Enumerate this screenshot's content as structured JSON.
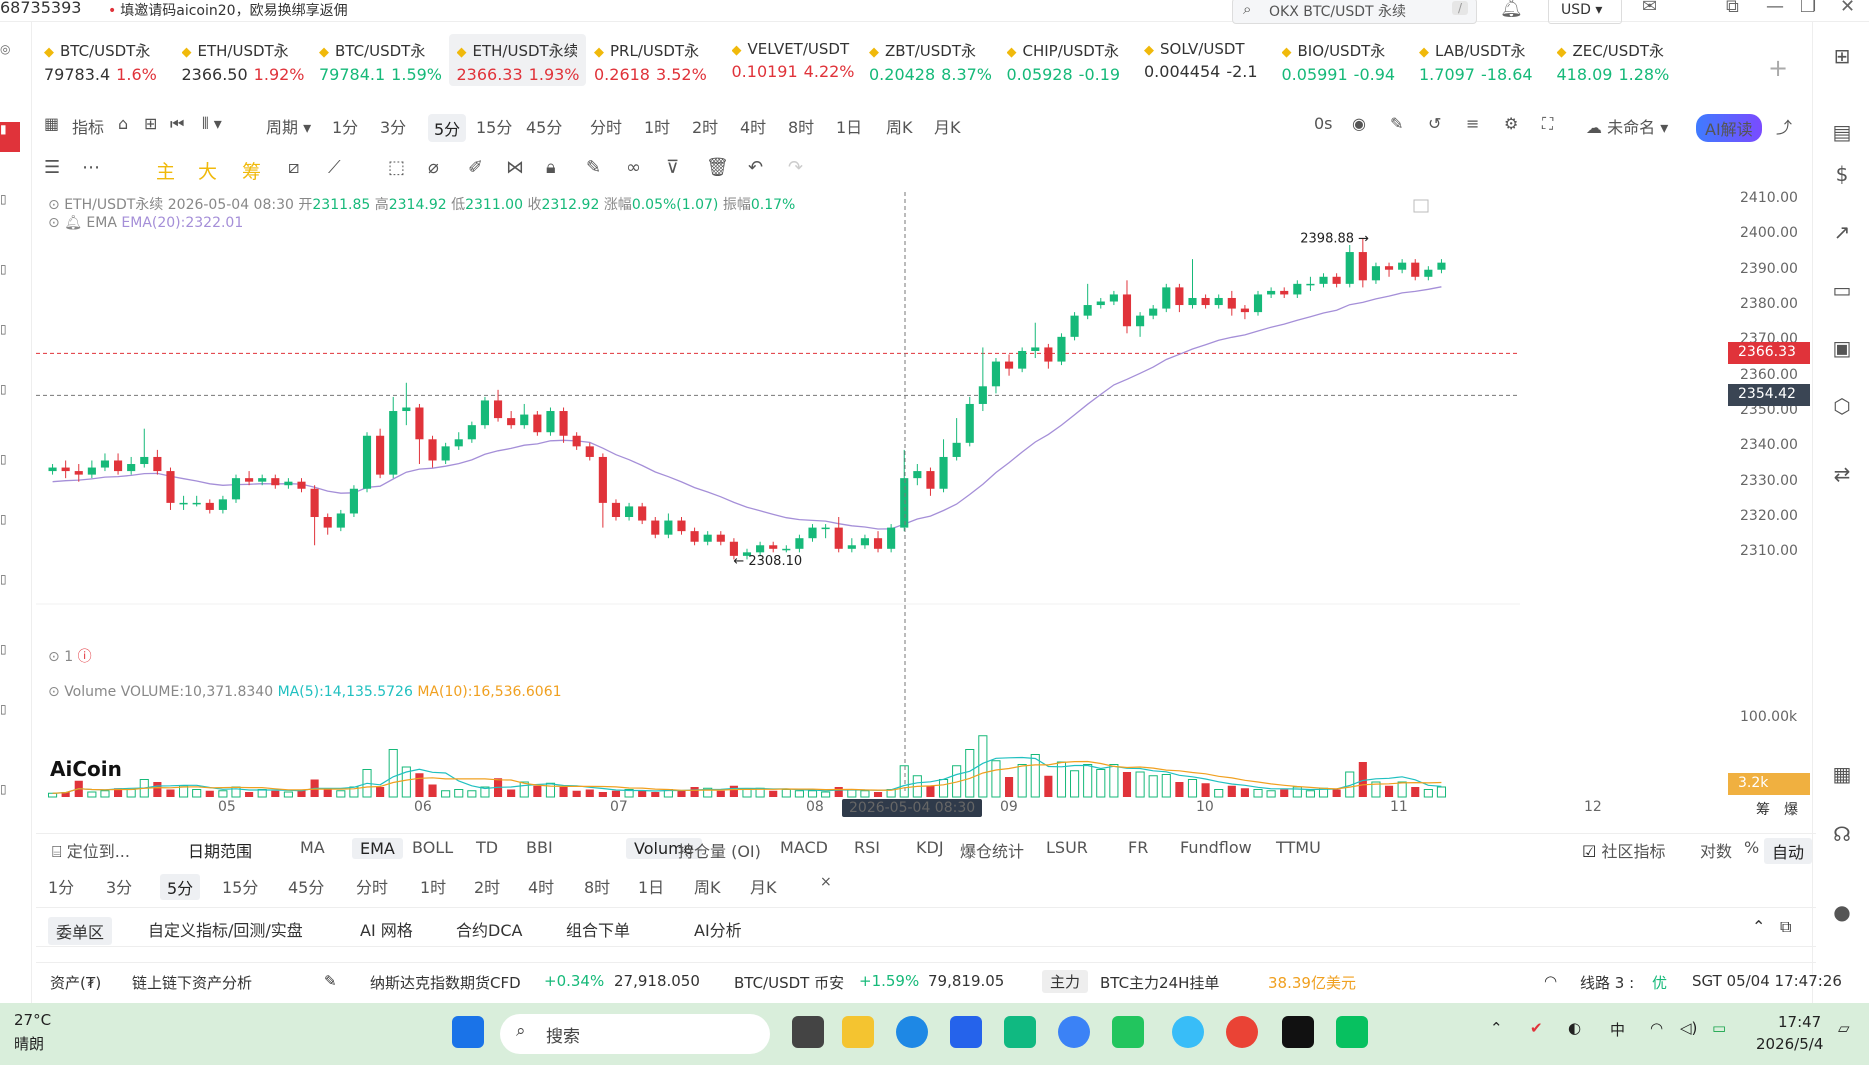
{
  "top": {
    "uid": "68735393",
    "promo": "填邀请码aicoin20，欧易换绑享返佣",
    "search_placeholder": "OKX BTC/USDT 永续",
    "search_shortcut": "/",
    "currency": "USD"
  },
  "tickers": [
    {
      "name": "BTC/USDT永",
      "price": "79783.4",
      "change": "1.6%",
      "dir": "dn",
      "price_dir": "neutral"
    },
    {
      "name": "ETH/USDT永",
      "price": "2366.50",
      "change": "1.92%",
      "dir": "dn",
      "price_dir": "neutral"
    },
    {
      "name": "BTC/USDT永",
      "price": "79784.1",
      "change": "1.59%",
      "dir": "up",
      "price_dir": "up"
    },
    {
      "name": "ETH/USDT永续",
      "price": "2366.33",
      "change": "1.93%",
      "dir": "dn",
      "price_dir": "dn",
      "active": true
    },
    {
      "name": "PRL/USDT永",
      "price": "0.2618",
      "change": "3.52%",
      "dir": "dn",
      "price_dir": "dn"
    },
    {
      "name": "VELVET/USDT",
      "price": "0.10191",
      "change": "4.22%",
      "dir": "dn",
      "price_dir": "dn"
    },
    {
      "name": "ZBT/USDT永",
      "price": "0.20428",
      "change": "8.37%",
      "dir": "up",
      "price_dir": "up"
    },
    {
      "name": "CHIP/USDT永",
      "price": "0.05928",
      "change": "-0.19",
      "dir": "up",
      "price_dir": "up"
    },
    {
      "name": "SOLV/USDT",
      "price": "0.004454",
      "change": "-2.1",
      "dir": "neutral",
      "price_dir": "neutral"
    },
    {
      "name": "BIO/USDT永",
      "price": "0.05991",
      "change": "-0.94",
      "dir": "up",
      "price_dir": "up"
    },
    {
      "name": "LAB/USDT永",
      "price": "1.7097",
      "change": "-18.64",
      "dir": "up",
      "price_dir": "up"
    },
    {
      "name": "ZEC/USDT永",
      "price": "418.09",
      "change": "1.28%",
      "dir": "up",
      "price_dir": "up"
    }
  ],
  "toolbar": {
    "indicators": "指标",
    "period": "周期",
    "timeframes": [
      "1分",
      "3分",
      "5分",
      "15分",
      "45分",
      "分时",
      "1时",
      "2时",
      "4时",
      "8时",
      "1日",
      "周K",
      "月K"
    ],
    "selected_tf": "5分",
    "countdown": "0s",
    "layout_name": "未命名",
    "ai_label": "AI解读"
  },
  "drawbar": {
    "labels": [
      "主",
      "大",
      "筹"
    ]
  },
  "chart": {
    "symbol": "ETH/USDT永续",
    "datetime": "2026-05-04 08:30",
    "open_label": "开",
    "open": "2311.85",
    "high_label": "高",
    "high": "2314.92",
    "low_label": "低",
    "low": "2311.00",
    "close_label": "收",
    "close": "2312.92",
    "chg_label": "涨幅",
    "chg": "0.05%(1.07)",
    "amp_label": "振幅",
    "amp": "0.17%",
    "ema_label": "EMA",
    "ema_value": "EMA(20):2322.01",
    "max_marker": "2398.88 →",
    "min_marker": "← 2308.10",
    "alert_count": "1",
    "price_ticks": [
      "2410.00",
      "2400.00",
      "2390.00",
      "2380.00",
      "2370.00",
      "2360.00",
      "2350.00",
      "2340.00",
      "2330.00",
      "2320.00",
      "2310.00"
    ],
    "last_price": "2366.33",
    "cursor_price": "2354.42",
    "volume_label": "Volume",
    "volume_value": "VOLUME:10,371.8340",
    "ma5": "MA(5):14,135.5726",
    "ma10": "MA(10):16,536.6061",
    "vol_tick": "100.00k",
    "vol_last": "3.2k",
    "date_ticks": [
      "05",
      "06",
      "07",
      "08",
      "09",
      "10",
      "11",
      "12"
    ],
    "cursor_date": "2026-05-04 08:30",
    "corner_labels": [
      "筹",
      "爆"
    ],
    "logo": "AiCoin"
  },
  "chart_data": {
    "type": "candlestick",
    "title": "ETH/USDT永续 5分",
    "ylim": [
      2305,
      2412
    ],
    "ema20_end": 2383,
    "high_marker": 2398.88,
    "low_marker": 2308.1,
    "candles": [
      [
        2333,
        2334,
        2332,
        2335
      ],
      [
        2334,
        2333,
        2331,
        2336
      ],
      [
        2333,
        2332,
        2330,
        2335
      ],
      [
        2332,
        2334,
        2331,
        2336
      ],
      [
        2334,
        2336,
        2333,
        2338
      ],
      [
        2336,
        2333,
        2332,
        2338
      ],
      [
        2333,
        2335,
        2332,
        2337
      ],
      [
        2335,
        2337,
        2334,
        2345
      ],
      [
        2337,
        2333,
        2332,
        2339
      ],
      [
        2333,
        2324,
        2322,
        2334
      ],
      [
        2324,
        2324,
        2322,
        2326
      ],
      [
        2324,
        2324,
        2323,
        2326
      ],
      [
        2324,
        2322,
        2321,
        2325
      ],
      [
        2322,
        2325,
        2321,
        2326
      ],
      [
        2325,
        2331,
        2324,
        2332
      ],
      [
        2331,
        2330,
        2329,
        2333
      ],
      [
        2330,
        2331,
        2329,
        2332
      ],
      [
        2331,
        2329,
        2328,
        2332
      ],
      [
        2329,
        2330,
        2328,
        2331
      ],
      [
        2330,
        2328,
        2327,
        2331
      ],
      [
        2328,
        2320,
        2312,
        2329
      ],
      [
        2320,
        2317,
        2315,
        2321
      ],
      [
        2317,
        2321,
        2316,
        2322
      ],
      [
        2321,
        2328,
        2320,
        2329
      ],
      [
        2328,
        2343,
        2327,
        2344
      ],
      [
        2343,
        2332,
        2331,
        2345
      ],
      [
        2332,
        2350,
        2331,
        2354
      ],
      [
        2350,
        2351,
        2346,
        2358
      ],
      [
        2351,
        2342,
        2335,
        2352
      ],
      [
        2342,
        2336,
        2334,
        2343
      ],
      [
        2336,
        2340,
        2335,
        2341
      ],
      [
        2340,
        2342,
        2339,
        2344
      ],
      [
        2342,
        2346,
        2341,
        2347
      ],
      [
        2346,
        2353,
        2345,
        2354
      ],
      [
        2353,
        2348,
        2347,
        2356
      ],
      [
        2348,
        2346,
        2345,
        2350
      ],
      [
        2346,
        2349,
        2345,
        2352
      ],
      [
        2349,
        2344,
        2343,
        2350
      ],
      [
        2344,
        2350,
        2343,
        2351
      ],
      [
        2350,
        2343,
        2341,
        2351
      ],
      [
        2343,
        2340,
        2339,
        2344
      ],
      [
        2340,
        2337,
        2336,
        2341
      ],
      [
        2337,
        2324,
        2317,
        2338
      ],
      [
        2324,
        2320,
        2319,
        2325
      ],
      [
        2320,
        2323,
        2319,
        2324
      ],
      [
        2323,
        2319,
        2318,
        2324
      ],
      [
        2319,
        2315,
        2314,
        2320
      ],
      [
        2315,
        2319,
        2314,
        2321
      ],
      [
        2319,
        2316,
        2315,
        2320
      ],
      [
        2316,
        2313,
        2312,
        2317
      ],
      [
        2313,
        2315,
        2312,
        2316
      ],
      [
        2315,
        2313,
        2312,
        2316
      ],
      [
        2313,
        2309,
        2308,
        2314
      ],
      [
        2309,
        2310,
        2308,
        2311
      ],
      [
        2310,
        2312,
        2309,
        2313
      ],
      [
        2312,
        2311,
        2310,
        2313
      ],
      [
        2311,
        2311,
        2310,
        2312
      ],
      [
        2311,
        2314,
        2310,
        2315
      ],
      [
        2314,
        2317,
        2313,
        2318
      ],
      [
        2317,
        2317,
        2314,
        2318
      ],
      [
        2317,
        2311,
        2310,
        2320
      ],
      [
        2311,
        2312,
        2310,
        2314
      ],
      [
        2312,
        2314,
        2311,
        2315
      ],
      [
        2314,
        2311,
        2310,
        2316
      ],
      [
        2311,
        2317,
        2310,
        2318
      ],
      [
        2317,
        2331,
        2316,
        2339
      ],
      [
        2331,
        2333,
        2329,
        2335
      ],
      [
        2333,
        2328,
        2326,
        2334
      ],
      [
        2328,
        2337,
        2327,
        2342
      ],
      [
        2337,
        2341,
        2336,
        2348
      ],
      [
        2341,
        2352,
        2340,
        2354
      ],
      [
        2352,
        2357,
        2350,
        2368
      ],
      [
        2357,
        2364,
        2355,
        2365
      ],
      [
        2364,
        2362,
        2360,
        2366
      ],
      [
        2362,
        2367,
        2361,
        2368
      ],
      [
        2367,
        2368,
        2365,
        2375
      ],
      [
        2368,
        2364,
        2362,
        2369
      ],
      [
        2364,
        2371,
        2363,
        2372
      ],
      [
        2371,
        2377,
        2370,
        2378
      ],
      [
        2377,
        2380,
        2376,
        2386
      ],
      [
        2380,
        2381,
        2379,
        2382
      ],
      [
        2381,
        2383,
        2380,
        2384
      ],
      [
        2383,
        2374,
        2372,
        2387
      ],
      [
        2374,
        2377,
        2371,
        2378
      ],
      [
        2377,
        2379,
        2376,
        2380
      ],
      [
        2379,
        2385,
        2378,
        2386
      ],
      [
        2385,
        2380,
        2378,
        2386
      ],
      [
        2380,
        2382,
        2379,
        2393
      ],
      [
        2382,
        2380,
        2379,
        2383
      ],
      [
        2380,
        2382,
        2379,
        2383
      ],
      [
        2382,
        2379,
        2377,
        2384
      ],
      [
        2379,
        2378,
        2376,
        2380
      ],
      [
        2378,
        2383,
        2377,
        2384
      ],
      [
        2383,
        2384,
        2382,
        2385
      ],
      [
        2384,
        2383,
        2382,
        2385
      ],
      [
        2383,
        2386,
        2382,
        2387
      ],
      [
        2386,
        2386,
        2384,
        2388
      ],
      [
        2386,
        2388,
        2385,
        2389
      ],
      [
        2388,
        2386,
        2385,
        2389
      ],
      [
        2386,
        2395,
        2385,
        2397
      ],
      [
        2395,
        2387,
        2385,
        2399
      ],
      [
        2387,
        2391,
        2386,
        2392
      ],
      [
        2391,
        2390,
        2388,
        2392
      ],
      [
        2390,
        2392,
        2389,
        2393
      ],
      [
        2392,
        2388,
        2387,
        2393
      ],
      [
        2388,
        2390,
        2387,
        2391
      ],
      [
        2390,
        2392,
        2389,
        2393
      ]
    ],
    "volumes": [
      3,
      4,
      13,
      4,
      5,
      7,
      6,
      14,
      12,
      6,
      9,
      6,
      5,
      5,
      8,
      4,
      6,
      5,
      4,
      6,
      14,
      6,
      5,
      8,
      22,
      8,
      38,
      24,
      19,
      10,
      5,
      6,
      5,
      8,
      15,
      6,
      12,
      9,
      11,
      8,
      5,
      6,
      4,
      5,
      6,
      5,
      4,
      6,
      5,
      8,
      7,
      5,
      9,
      6,
      7,
      5,
      6,
      5,
      5,
      4,
      8,
      6,
      5,
      4,
      6,
      25,
      17,
      9,
      14,
      25,
      38,
      49,
      29,
      16,
      26,
      34,
      17,
      28,
      21,
      26,
      22,
      26,
      20,
      20,
      17,
      18,
      12,
      14,
      11,
      6,
      9,
      7,
      6,
      5,
      6,
      8,
      5,
      7,
      6,
      20,
      28,
      12,
      9,
      12,
      8,
      6,
      8
    ]
  },
  "indicators": {
    "locate": "定位到...",
    "date_range": "日期范围",
    "main": [
      "MA",
      "EMA",
      "BOLL",
      "TD",
      "BBI"
    ],
    "main_selected": "EMA",
    "sub": [
      "Volume",
      "持仓量 (OI)",
      "MACD",
      "RSI",
      "KDJ",
      "爆仓统计",
      "LSUR",
      "FR",
      "Fundflow",
      "TTMU"
    ],
    "sub_selected": "Volume",
    "community": "社区指标",
    "log": "对数",
    "pct": "%",
    "auto": "自动"
  },
  "tf2": {
    "items": [
      "1分",
      "3分",
      "5分",
      "15分",
      "45分",
      "分时",
      "1时",
      "2时",
      "4时",
      "8时",
      "1日",
      "周K",
      "月K"
    ],
    "selected": "5分",
    "close": "×"
  },
  "tabs": [
    "委单区",
    "自定义指标/回测/实盘",
    "AI 网格",
    "合约DCA",
    "组合下单",
    "AI分析"
  ],
  "tabs_selected": "委单区",
  "status": {
    "assets": "资产(₮)",
    "analysis": "链上链下资产分析",
    "ndx_name": "纳斯达克指数期货CFD",
    "ndx_chg": "+0.34%",
    "ndx_price": "27,918.050",
    "btc_name": "BTC/USDT 币安",
    "btc_chg": "+1.59%",
    "btc_price": "79,819.05",
    "main_badge": "主力",
    "btc_orders": "BTC主力24H挂单",
    "btc_orders_val": "38.39亿美元",
    "line": "线路 3 : ",
    "line_quality": "优",
    "clock": "SGT 05/04 17:47:26"
  },
  "taskbar": {
    "temp": "27°C",
    "weather": "晴朗",
    "search": "搜索",
    "time": "17:47",
    "date": "2026/5/4",
    "ime": "中"
  },
  "colors": {
    "up": "#16b979",
    "down": "#e0333a",
    "ema": "#a58fd8",
    "ma5": "#20c0c0",
    "ma10": "#f0a020",
    "accent": "#3f7bff"
  }
}
